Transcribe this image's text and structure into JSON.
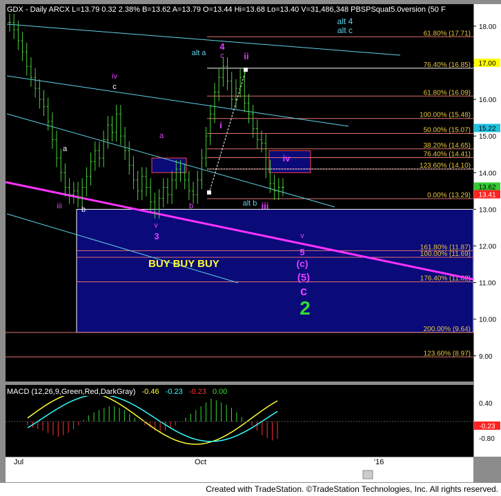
{
  "header": {
    "text": "GDX - Daily  ARCX  L=13.79  0.32  2.38%   B=13.62  A=13.79  O=13.44  Hi=13.68  Lo=13.40  V=31,486,348  PBSPSquat5.0version (50 F"
  },
  "footer": {
    "text": "Created with TradeStation. ©TradeStation Technologies, Inc. All rights reserved."
  },
  "colors": {
    "background": "#000000",
    "buyBox": "#0a0a78",
    "candle": "#4bd13a",
    "magentaLine": "#ff33ff",
    "cyanChannel": "#5fd3e8",
    "fibText": "#e8c63a",
    "waveMagenta": "#e040ff",
    "waveCyan": "#5fd3e8",
    "waveGreen": "#33dd33",
    "buyText": "#ffff33"
  },
  "macd": {
    "label": "MACD (12,26,9,Green,Red,DarkGray)",
    "v1": "-0.46",
    "v2": "-0.23",
    "v3": "-0.23",
    "v4": "0.00"
  },
  "chart_data": {
    "type": "candlestick",
    "ylim": [
      8.3,
      18.6
    ],
    "y_ticks": [
      9,
      10,
      11,
      12,
      13,
      14,
      15,
      16,
      17,
      18
    ],
    "macd_ticks": [
      "0.40",
      "-0.80"
    ],
    "x_labels": [
      "Jul",
      "Oct",
      "'16"
    ],
    "price_flags": [
      {
        "label": "17.00",
        "value": 17.0,
        "bg": "#ffff00",
        "fg": "#000000"
      },
      {
        "label": "15.22",
        "value": 15.22,
        "bg": "#20c0e0",
        "fg": "#000000"
      },
      {
        "label": "13.62",
        "value": 13.62,
        "bg": "#33cc33",
        "fg": "#000000"
      },
      {
        "label": "13.41",
        "value": 13.41,
        "bg": "#ff2222",
        "fg": "#ffffff"
      }
    ],
    "fib_levels": [
      {
        "label": "61.80% (17.71)",
        "value": 17.71
      },
      {
        "label": "76.40% (16.85)",
        "value": 16.85
      },
      {
        "label": "61.80% (16.09)",
        "value": 16.09
      },
      {
        "label": "100.00% (15.48)",
        "value": 15.48
      },
      {
        "label": "50.00% (15.07)",
        "value": 15.07
      },
      {
        "label": "38.20% (14.65)",
        "value": 14.65
      },
      {
        "label": "76.40% (14.41)",
        "value": 14.41
      },
      {
        "label": "123.60% (14.10)",
        "value": 14.1
      },
      {
        "label": "0.00% (13.29)",
        "value": 13.29
      },
      {
        "label": "161.80% (11.87)",
        "value": 11.87
      },
      {
        "label": "100.00% (11.69)",
        "value": 11.69
      },
      {
        "label": "176.40% (11.02)",
        "value": 11.02
      },
      {
        "label": "200.00% (9.64)",
        "value": 9.64
      },
      {
        "label": "123.60% (8.97)",
        "value": 8.97
      }
    ],
    "buy_label": "BUY  BUY  BUY",
    "wave_labels": [
      {
        "text": "alt 4",
        "color": "cyan"
      },
      {
        "text": "alt c",
        "color": "cyan"
      },
      {
        "text": "alt a",
        "color": "cyan"
      },
      {
        "text": "4",
        "color": "magenta"
      },
      {
        "text": "c",
        "color": "magenta"
      },
      {
        "text": "ii",
        "color": "magenta"
      },
      {
        "text": "iv",
        "color": "magenta"
      },
      {
        "text": "c",
        "color": "white"
      },
      {
        "text": "i",
        "color": "magenta"
      },
      {
        "text": "a",
        "color": "magenta"
      },
      {
        "text": "a",
        "color": "white"
      },
      {
        "text": "iv",
        "color": "magenta"
      },
      {
        "text": "iii",
        "color": "magenta"
      },
      {
        "text": "b",
        "color": "white"
      },
      {
        "text": "b",
        "color": "magenta"
      },
      {
        "text": "alt b",
        "color": "cyan"
      },
      {
        "text": "iii",
        "color": "magenta"
      },
      {
        "text": "v",
        "color": "magenta"
      },
      {
        "text": "3",
        "color": "magenta"
      },
      {
        "text": "v",
        "color": "magenta"
      },
      {
        "text": "5",
        "color": "magenta"
      },
      {
        "text": "(c)",
        "color": "magenta"
      },
      {
        "text": "(5)",
        "color": "magenta"
      },
      {
        "text": "c",
        "color": "magenta"
      },
      {
        "text": "2",
        "color": "green"
      }
    ],
    "closes": [
      18.1,
      17.9,
      17.6,
      17.3,
      16.9,
      16.6,
      16.3,
      16.0,
      15.8,
      15.4,
      14.9,
      14.4,
      14.0,
      13.6,
      13.4,
      13.5,
      13.3,
      13.6,
      13.9,
      14.3,
      14.6,
      14.4,
      14.9,
      15.3,
      15.1,
      15.6,
      15.0,
      14.6,
      14.2,
      13.8,
      13.5,
      13.9,
      13.6,
      13.2,
      13.0,
      13.3,
      13.6,
      13.4,
      13.8,
      14.1,
      14.0,
      13.8,
      13.5,
      13.4,
      13.8,
      14.4,
      15.0,
      15.6,
      16.2,
      16.6,
      16.9,
      16.5,
      16.0,
      16.3,
      16.6,
      15.9,
      15.6,
      15.2,
      14.9,
      14.8,
      14.1,
      13.7,
      13.5,
      13.6,
      13.6
    ],
    "macd_hist": [
      -0.05,
      -0.08,
      -0.1,
      -0.12,
      -0.15,
      -0.18,
      -0.2,
      -0.18,
      -0.15,
      -0.1,
      -0.05,
      0.02,
      0.08,
      0.12,
      0.15,
      0.18,
      0.2,
      0.2,
      0.18,
      0.15,
      0.1,
      0.05,
      0.0,
      -0.05,
      -0.08,
      -0.12,
      -0.15,
      -0.12,
      -0.08,
      -0.05,
      0.0,
      0.05,
      0.1,
      0.15,
      0.2,
      0.25,
      0.3,
      0.28,
      0.25,
      0.22,
      0.18,
      0.12,
      0.06,
      0.0,
      -0.06,
      -0.12,
      -0.18,
      -0.22,
      -0.25,
      -0.23
    ]
  }
}
